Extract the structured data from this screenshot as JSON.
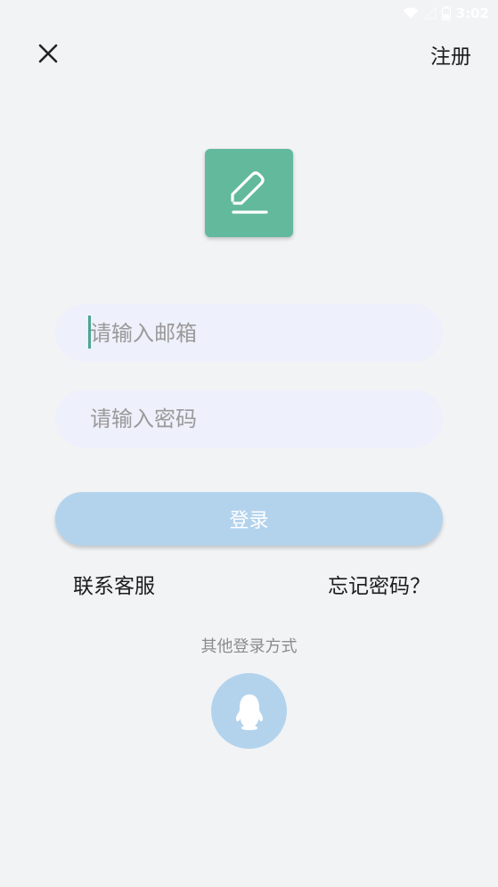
{
  "status_bar": {
    "time": "3:02",
    "icons": [
      "wifi-icon",
      "signal-icon",
      "battery-icon"
    ]
  },
  "header": {
    "close_icon": "close-icon",
    "register_label": "注册"
  },
  "logo": {
    "icon": "pencil-edit-icon",
    "background": "#63b99c"
  },
  "form": {
    "email_placeholder": "请输入邮箱",
    "email_value": "",
    "password_placeholder": "请输入密码",
    "password_value": "",
    "login_label": "登录"
  },
  "links": {
    "contact_service": "联系客服",
    "forgot_password": "忘记密码？"
  },
  "other_login": {
    "label": "其他登录方式",
    "providers": [
      {
        "name": "qq",
        "icon": "qq-penguin-icon"
      }
    ]
  },
  "colors": {
    "accent_green": "#63b99c",
    "button_blue": "#b3d3ed",
    "input_bg": "#eef0fb",
    "page_bg": "#f2f3f5"
  }
}
